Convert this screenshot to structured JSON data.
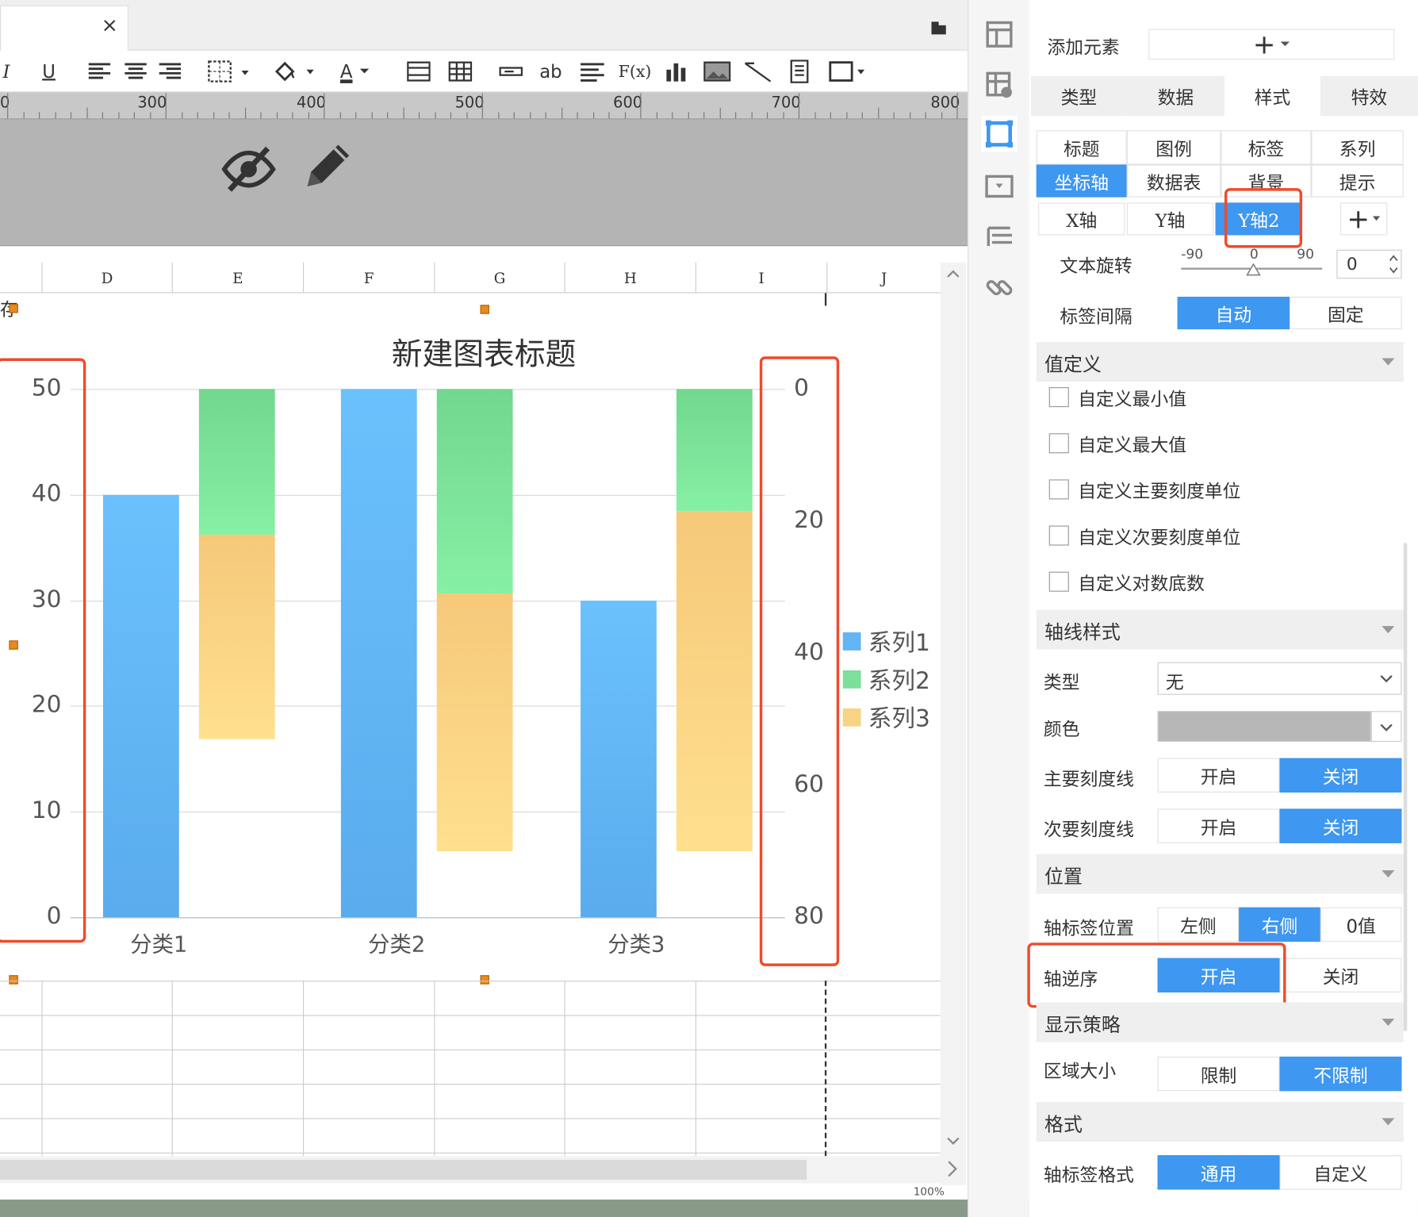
{
  "chart_data": {
    "type": "bar",
    "title": "新建图表标题",
    "categories": [
      "分类1",
      "分类2",
      "分类3"
    ],
    "series": [
      {
        "name": "系列1",
        "axis": "y",
        "values": [
          40,
          50,
          30
        ],
        "color": "#63b5f5"
      },
      {
        "name": "系列2",
        "axis": "y2",
        "stack": "s",
        "values": [
          [
            0,
            22
          ],
          [
            0,
            31
          ],
          [
            0,
            18.5
          ]
        ],
        "color": "#7ddf98"
      },
      {
        "name": "系列3",
        "axis": "y2",
        "stack": "s",
        "values": [
          [
            22,
            53
          ],
          [
            31,
            70
          ],
          [
            18.5,
            70
          ]
        ],
        "color": "#f9d384"
      }
    ],
    "y_ticks": [
      "0",
      "10",
      "20",
      "30",
      "40",
      "50"
    ],
    "ylim": [
      0,
      50
    ],
    "y2_ticks": [
      "0",
      "20",
      "40",
      "60",
      "80"
    ],
    "y2lim": [
      0,
      80
    ],
    "y2_reversed": true,
    "legend_position": "right",
    "grid": true
  },
  "editor": {
    "tab_close": "×",
    "ruler_labels": [
      "0",
      "300",
      "400",
      "500",
      "600",
      "700",
      "800"
    ],
    "columns": [
      "D",
      "E",
      "F",
      "G",
      "H",
      "I",
      "J"
    ],
    "cell_text": "存",
    "toolbar_ab": "ab",
    "toolbar_fx": "F(x)",
    "toolbar_font_a": "A",
    "toolbar_u": "U",
    "toolbar_i": "I",
    "zoom": "100%"
  },
  "panel": {
    "add_element": "添加元素",
    "add_symbol": "+",
    "main_tabs": [
      "类型",
      "数据",
      "样式",
      "特效"
    ],
    "sub_tabs": [
      "标题",
      "图例",
      "标签",
      "系列",
      "坐标轴",
      "数据表",
      "背景",
      "提示"
    ],
    "axis_tabs": [
      "X轴",
      "Y轴",
      "Y轴2"
    ],
    "axis_add": "+",
    "text_rotate": "文本旋转",
    "rotate_ticks": [
      "-90",
      "0",
      "90"
    ],
    "rotate_value": "0",
    "label_interval": "标签间隔",
    "interval_options": [
      "自动",
      "固定"
    ],
    "value_def": "值定义",
    "checks": [
      "自定义最小值",
      "自定义最大值",
      "自定义主要刻度单位",
      "自定义次要刻度单位",
      "自定义对数底数"
    ],
    "axis_line_style": "轴线样式",
    "type_label": "类型",
    "type_value": "无",
    "color_label": "颜色",
    "color_value": "#b7b7b7",
    "major_tick": "主要刻度线",
    "minor_tick": "次要刻度线",
    "on_off": [
      "开启",
      "关闭"
    ],
    "position": "位置",
    "label_pos": "轴标签位置",
    "label_pos_options": [
      "左侧",
      "右侧",
      "0值"
    ],
    "reverse": "轴逆序",
    "display_strategy": "显示策略",
    "area_size": "区域大小",
    "area_options": [
      "限制",
      "不限制"
    ],
    "format": "格式",
    "label_format": "轴标签格式",
    "format_options": [
      "通用",
      "自定义"
    ]
  }
}
